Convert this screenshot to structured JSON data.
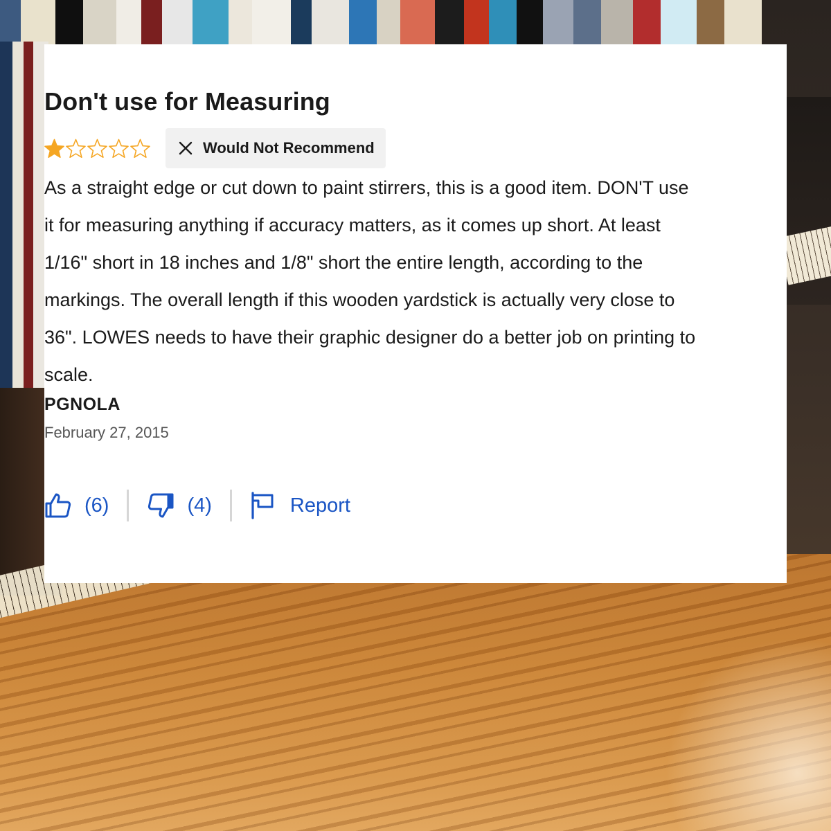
{
  "review": {
    "title": "Don't use for Measuring",
    "rating": 1,
    "rating_max": 5,
    "recommend_badge": "Would Not Recommend",
    "body": "As a straight edge or cut down to paint stirrers, this is a good item. DON'T use it for measuring anything if accuracy matters, as it comes up short. At least 1/16\" short in 18 inches and 1/8\" short the entire length, according to the markings. The overall length if this wooden yardstick is actually very close to 36\". LOWES needs to have their graphic designer do a better job on printing to scale.",
    "author": "PGNOLA",
    "date": "February 27, 2015"
  },
  "actions": {
    "helpful_count": "(6)",
    "not_helpful_count": "(4)",
    "report_label": "Report"
  },
  "colors": {
    "star": "#f5a623",
    "link": "#1a55c4",
    "badge_bg": "#f1f1f1"
  },
  "icons": [
    "star-icon",
    "close-x-icon",
    "thumbs-up-icon",
    "thumbs-down-icon",
    "flag-icon"
  ]
}
